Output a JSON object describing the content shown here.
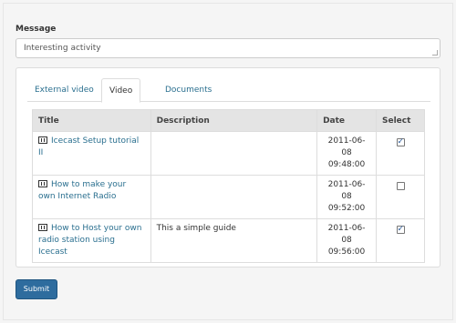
{
  "message": {
    "label": "Message",
    "value": "Interesting activity"
  },
  "tabs": [
    {
      "label": "External video",
      "active": false
    },
    {
      "label": "Video",
      "active": true
    },
    {
      "label": "Documents",
      "active": false
    }
  ],
  "table": {
    "headers": [
      "Title",
      "Description",
      "Date",
      "Select"
    ],
    "rows": [
      {
        "title": "Icecast Setup tutorial II",
        "description": "",
        "date": "2011-06-08 09:48:00",
        "selected": true,
        "icon": "film-icon"
      },
      {
        "title": "How to make your own Internet Radio",
        "description": "",
        "date": "2011-06-08 09:52:00",
        "selected": false,
        "icon": "film-icon"
      },
      {
        "title": "How to Host your own radio station using Icecast",
        "description": "This a simple guide",
        "date": "2011-06-08 09:56:00",
        "selected": true,
        "icon": "film-icon"
      }
    ]
  },
  "submit_label": "Submit",
  "colors": {
    "link": "#2a6f8f",
    "button": "#2e6c9e"
  }
}
